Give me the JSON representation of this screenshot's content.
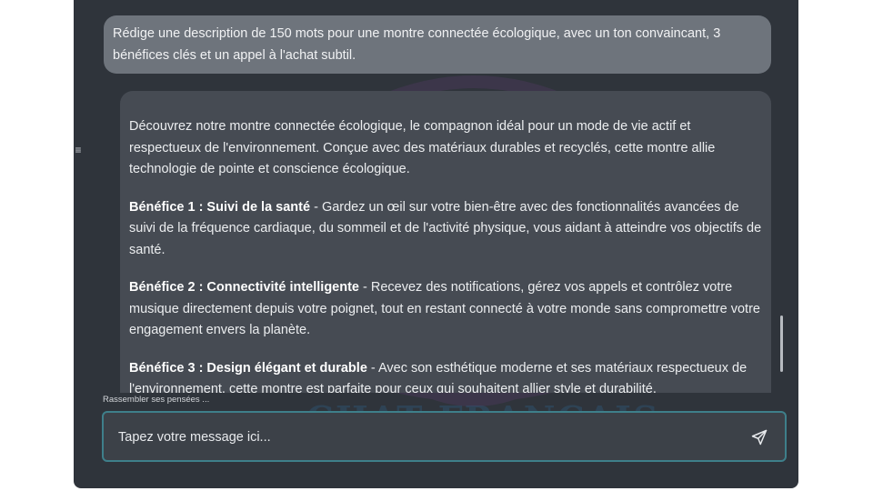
{
  "chat": {
    "user_message": "Rédige une description de 150 mots pour une montre connectée écologique, avec un ton convaincant, 3 bénéfices clés et un appel à l'achat subtil.",
    "assistant": {
      "intro": "Découvrez notre montre connectée écologique, le compagnon idéal pour un mode de vie actif et respectueux de l'environnement. Conçue avec des matériaux durables et recyclés, cette montre allie technologie de pointe et conscience écologique.",
      "benefits": [
        {
          "title": "Bénéfice 1 : Suivi de la santé",
          "text": " - Gardez un œil sur votre bien-être avec des fonctionnalités avancées de suivi de la fréquence cardiaque, du sommeil et de l'activité physique, vous aidant à atteindre vos objectifs de santé."
        },
        {
          "title": "Bénéfice 2 : Connectivité intelligente",
          "text": " - Recevez des notifications, gérez vos appels et contrôlez votre musique directement depuis votre poignet, tout en restant connecté à votre monde sans compromettre votre engagement envers la planète."
        },
        {
          "title": "Bénéfice 3 : Design élégant et durable",
          "text": " - Avec son esthétique moderne et ses matériaux respectueux de l'environnement, cette montre est parfaite pour ceux qui souhaitent allier style et durabilité."
        }
      ]
    },
    "status_text": "Rassembler ses pensées ...",
    "input": {
      "placeholder": "Tapez votre message ici..."
    },
    "watermark_text": "CHAT FRANCAIS"
  },
  "icons": {
    "menu": "menu-icon",
    "send": "send-icon"
  },
  "colors": {
    "background": "#2f343b",
    "user_bubble": "#6e747c",
    "assistant_bubble": "#464b53",
    "input_border": "#3e7f8a"
  }
}
